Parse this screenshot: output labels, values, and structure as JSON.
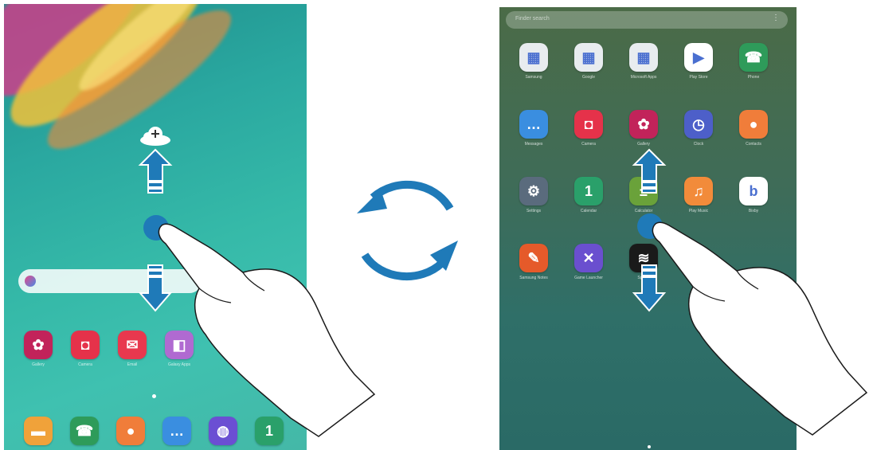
{
  "left_screen": {
    "home_row": [
      {
        "label": "Gallery",
        "icon": "gallery-icon",
        "color": "#c2235a"
      },
      {
        "label": "Camera",
        "icon": "camera-icon",
        "color": "#e5324a"
      },
      {
        "label": "Email",
        "icon": "email-icon",
        "color": "#e8384e"
      },
      {
        "label": "Galaxy Apps",
        "icon": "galaxy-apps-icon",
        "color": "#b06ad1"
      }
    ],
    "dock": [
      {
        "icon": "my-files-icon",
        "color": "#f0a23a"
      },
      {
        "icon": "phone-icon",
        "color": "#2e9b5a"
      },
      {
        "icon": "contacts-icon",
        "color": "#f07d3a"
      },
      {
        "icon": "messages-icon",
        "color": "#3a8ee0"
      },
      {
        "icon": "internet-icon",
        "color": "#6b4fd3"
      },
      {
        "icon": "calendar-icon",
        "color": "#2aa06a"
      }
    ]
  },
  "right_screen": {
    "search_placeholder": "Finder search",
    "grid": [
      [
        {
          "label": "Samsung",
          "icon": "samsung-folder-icon",
          "color": "#e8ecef"
        },
        {
          "label": "Google",
          "icon": "google-folder-icon",
          "color": "#e8ecef"
        },
        {
          "label": "Microsoft Apps",
          "icon": "microsoft-folder-icon",
          "color": "#e8ecef"
        },
        {
          "label": "Play Store",
          "icon": "play-store-icon",
          "color": "#ffffff"
        },
        {
          "label": "Phone",
          "icon": "phone-icon",
          "color": "#2e9b5a"
        }
      ],
      [
        {
          "label": "Messages",
          "icon": "messages-icon",
          "color": "#3a8ee0"
        },
        {
          "label": "Camera",
          "icon": "camera-icon",
          "color": "#e5324a"
        },
        {
          "label": "Gallery",
          "icon": "gallery-icon",
          "color": "#c2235a"
        },
        {
          "label": "Clock",
          "icon": "clock-icon",
          "color": "#4d5fc9"
        },
        {
          "label": "Contacts",
          "icon": "contacts-icon",
          "color": "#f07d3a"
        }
      ],
      [
        {
          "label": "Settings",
          "icon": "settings-icon",
          "color": "#5a6b7d"
        },
        {
          "label": "Calendar",
          "icon": "calendar-icon",
          "color": "#2aa06a"
        },
        {
          "label": "Calculator",
          "icon": "calculator-icon",
          "color": "#6aa23a"
        },
        {
          "label": "Play Music",
          "icon": "play-music-icon",
          "color": "#f28b3a"
        },
        {
          "label": "Bixby",
          "icon": "bixby-icon",
          "color": "#ffffff"
        }
      ],
      [
        {
          "label": "Samsung Notes",
          "icon": "samsung-notes-icon",
          "color": "#e55a2a"
        },
        {
          "label": "Game Launcher",
          "icon": "game-launcher-icon",
          "color": "#6a4fcf"
        },
        {
          "label": "Spotify",
          "icon": "spotify-icon",
          "color": "#1a1a1a"
        }
      ]
    ]
  },
  "colors": {
    "arrow": "#1f7ab8",
    "finger": "#ffffff"
  }
}
